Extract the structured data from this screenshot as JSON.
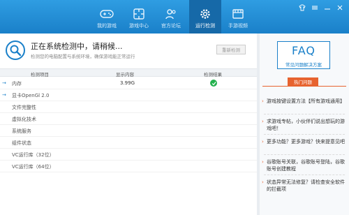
{
  "nav": [
    {
      "label": "我的游戏",
      "icon": "gamepad-icon"
    },
    {
      "label": "游戏中心",
      "icon": "puzzle-icon"
    },
    {
      "label": "官方论坛",
      "icon": "people-icon"
    },
    {
      "label": "运行检测",
      "icon": "gear-icon",
      "active": true
    },
    {
      "label": "手游视频",
      "icon": "film-icon"
    }
  ],
  "status": {
    "title": "正在系统检测中，请稍候...",
    "desc": "检测您的电脑配置与系统环境，确保游戏能正常运行",
    "recheck_label": "重新检测"
  },
  "table": {
    "headers": [
      "检测项目",
      "显示内容",
      "检测结果"
    ],
    "rows": [
      {
        "name": "内存",
        "value": "3.99G",
        "ok": true
      },
      {
        "name": "显卡OpenGl 2.0",
        "value": "",
        "ok": false
      },
      {
        "name": "文件完整性",
        "value": "",
        "ok": false
      },
      {
        "name": "虚拟化技术",
        "value": "",
        "ok": false
      },
      {
        "name": "系统服务",
        "value": "",
        "ok": false
      },
      {
        "name": "组件状态",
        "value": "",
        "ok": false
      },
      {
        "name": "VC运行库（32位）",
        "value": "",
        "ok": false
      },
      {
        "name": "VC运行库（64位）",
        "value": "",
        "ok": false
      }
    ]
  },
  "sidebar": {
    "faq_title": "FAQ",
    "faq_sub": "常见问题解决方案",
    "hot_label": "热门问题",
    "questions": [
      "游戏按键设置方法【所有游戏通用】",
      "求游戏专帖，小伙伴们说出想玩的游戏吧！",
      "更多功能？更多游戏？快来提意见吧",
      "谷歌账号关联，谷歌账号登陆，谷歌账号创建教程",
      "状态异常无法修复？请检查安全软件的拦截项"
    ]
  },
  "colors": {
    "brand": "#1a80c9",
    "accent": "#e7632f",
    "ok": "#23b14d"
  }
}
